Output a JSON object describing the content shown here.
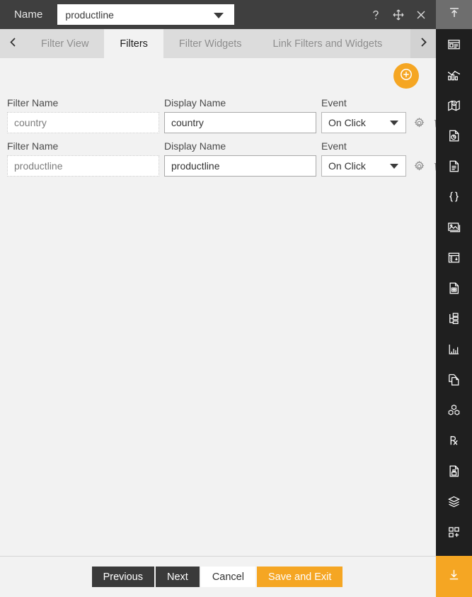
{
  "header": {
    "name_label": "Name",
    "selected_name": "productline",
    "help_icon": "question-mark-icon",
    "move_icon": "move-icon",
    "close_icon": "close-icon",
    "collapse_icon": "collapse-up-icon"
  },
  "tabs": {
    "prev_arrow": "chevron-left-icon",
    "next_arrow": "chevron-right-icon",
    "items": [
      {
        "label": "Filter View",
        "active": false
      },
      {
        "label": "Filters",
        "active": true
      },
      {
        "label": "Filter Widgets",
        "active": false
      },
      {
        "label": "Link Filters and Widgets",
        "active": false
      }
    ]
  },
  "content": {
    "add_button_icon": "plus-circle-icon",
    "columns": {
      "filter_name": "Filter Name",
      "display_name": "Display Name",
      "event": "Event"
    },
    "rows": [
      {
        "filter_name": "country",
        "display_name": "country",
        "event": "On Click",
        "settings_icon": "gear-icon",
        "delete_icon": "trash-icon"
      },
      {
        "filter_name": "productline",
        "display_name": "productline",
        "event": "On Click",
        "settings_icon": "gear-icon",
        "delete_icon": "trash-icon"
      }
    ]
  },
  "footer": {
    "previous": "Previous",
    "next": "Next",
    "cancel": "Cancel",
    "save_and_exit": "Save and Exit"
  },
  "sidebar": {
    "items": [
      {
        "icon": "dashboard-panel-icon"
      },
      {
        "icon": "chart-bar-line-icon"
      },
      {
        "icon": "map-pin-icon"
      },
      {
        "icon": "document-pie-chart-icon"
      },
      {
        "icon": "document-text-icon"
      },
      {
        "icon": "code-braces-icon"
      },
      {
        "icon": "image-gallery-icon"
      },
      {
        "icon": "table-widget-icon"
      },
      {
        "icon": "document-grid-icon"
      },
      {
        "icon": "tree-hierarchy-icon"
      },
      {
        "icon": "bar-chart-axis-icon"
      },
      {
        "icon": "copy-document-icon"
      },
      {
        "icon": "cubes-icon"
      },
      {
        "icon": "prescription-rx-icon"
      },
      {
        "icon": "document-save-icon"
      },
      {
        "icon": "layers-icon"
      },
      {
        "icon": "add-widget-icon"
      }
    ],
    "bottom_icon": "download-arrow-icon"
  },
  "colors": {
    "accent": "#f5a623",
    "header_bg": "#3f3f3f",
    "sidebar_bg": "#1f1f1f",
    "content_bg": "#f2f2f2"
  }
}
